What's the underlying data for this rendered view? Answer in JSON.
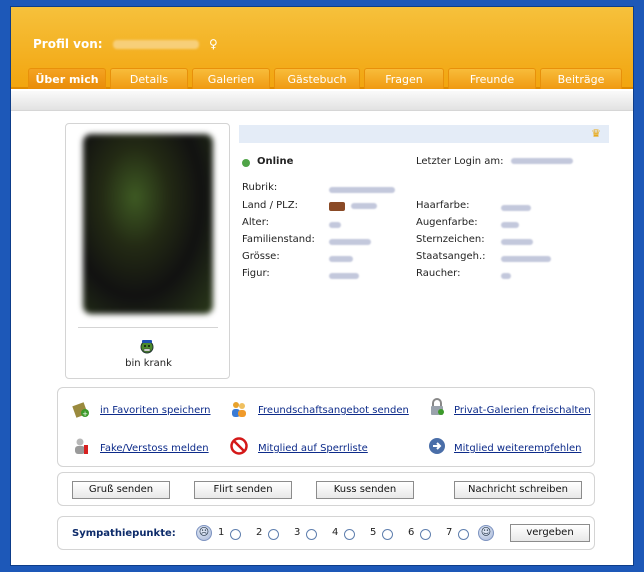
{
  "header": {
    "title_prefix": "Profil von:",
    "name_blurred": "Engelinderschen",
    "gender_symbol": "♀"
  },
  "tabs": [
    {
      "label": "Über mich",
      "active": true
    },
    {
      "label": "Details",
      "active": false
    },
    {
      "label": "Galerien",
      "active": false
    },
    {
      "label": "Gästebuch",
      "active": false
    },
    {
      "label": "Fragen",
      "active": false
    },
    {
      "label": "Freunde",
      "active": false
    },
    {
      "label": "Beiträge",
      "active": false
    }
  ],
  "profile": {
    "mood": "bin krank",
    "status": "Online",
    "last_login_label": "Letzter Login am:",
    "fields_left": [
      {
        "label": "Rubrik:"
      },
      {
        "label": "Land / PLZ:"
      },
      {
        "label": "Alter:"
      },
      {
        "label": "Familienstand:"
      },
      {
        "label": "Grösse:"
      },
      {
        "label": "Figur:"
      }
    ],
    "fields_right": [
      {
        "label": "Haarfarbe:"
      },
      {
        "label": "Augenfarbe:"
      },
      {
        "label": "Sternzeichen:"
      },
      {
        "label": "Staatsangeh.:"
      },
      {
        "label": "Raucher:"
      }
    ]
  },
  "actions": {
    "favorite": "in Favoriten speichern",
    "friend": "Freundschaftsangebot senden",
    "gallery": "Privat-Galerien freischalten",
    "report": "Fake/Verstoss melden",
    "block": "Mitglied auf Sperrliste",
    "recommend": "Mitglied weiterempfehlen"
  },
  "buttons": {
    "greet": "Gruß senden",
    "flirt": "Flirt senden",
    "kiss": "Kuss senden",
    "message": "Nachricht schreiben"
  },
  "sympathy": {
    "label": "Sympathiepunkte:",
    "values": [
      "1",
      "2",
      "3",
      "4",
      "5",
      "6",
      "7"
    ],
    "submit": "vergeben"
  },
  "colors": {
    "header_orange": "#f2a50f",
    "frame_blue": "#1d58b8",
    "link_blue": "#0d2b8a",
    "online_green": "#4fa447"
  }
}
